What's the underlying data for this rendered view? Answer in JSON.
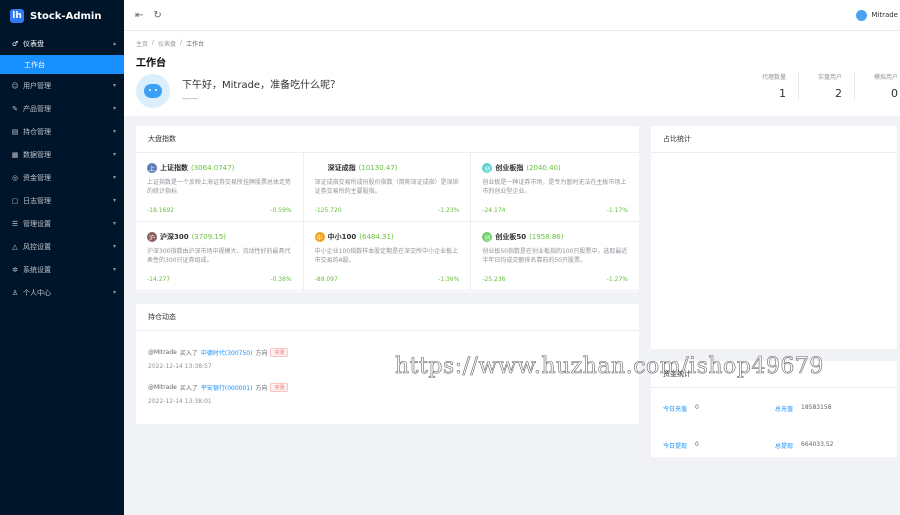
{
  "app": {
    "title": "Stock-Admin",
    "logo_glyph": "lh"
  },
  "sidebar": {
    "items": [
      {
        "icon": "dashboard-icon",
        "glyph": "♂",
        "label": "仪表盘",
        "open": true,
        "children": [
          {
            "label": "工作台",
            "active": true
          }
        ]
      },
      {
        "icon": "user-icon",
        "glyph": "☺",
        "label": "用户管理"
      },
      {
        "icon": "product-icon",
        "glyph": "✎",
        "label": "产品管理"
      },
      {
        "icon": "position-icon",
        "glyph": "▤",
        "label": "持仓管理"
      },
      {
        "icon": "data-icon",
        "glyph": "▦",
        "label": "数据管理"
      },
      {
        "icon": "fund-icon",
        "glyph": "◎",
        "label": "资金管理"
      },
      {
        "icon": "log-icon",
        "glyph": "▢",
        "label": "日志管理"
      },
      {
        "icon": "settings-admin-icon",
        "glyph": "☰",
        "label": "管理设置"
      },
      {
        "icon": "risk-icon",
        "glyph": "△",
        "label": "风控设置"
      },
      {
        "icon": "system-icon",
        "glyph": "✲",
        "label": "系统设置"
      },
      {
        "icon": "personal-icon",
        "glyph": "♙",
        "label": "个人中心"
      }
    ]
  },
  "header": {
    "collapse_glyph": "⇤",
    "refresh_glyph": "↻",
    "username": "Mitrade"
  },
  "breadcrumb": {
    "items": [
      "主页",
      "仪表盘",
      "工作台"
    ],
    "separator": "/"
  },
  "page": {
    "title": "工作台",
    "greeting": "下午好，Mitrade，准备吃什么呢？",
    "greeting_sub": "——",
    "stats": [
      {
        "label": "代理数量",
        "value": "1"
      },
      {
        "label": "实盘用户",
        "value": "2"
      },
      {
        "label": "模拟用户",
        "value": "0"
      }
    ]
  },
  "market": {
    "title": "大盘指数",
    "indices": [
      {
        "icon": "上",
        "color": "#5b7fb5",
        "name": "上证指数",
        "value": "(3064.0747)",
        "desc": "上证指数是一个反映上海证券交易所挂牌股票总体走势的统计指标",
        "change": "-18.1692",
        "pct": "-0.59%"
      },
      {
        "icon": "",
        "color": "#ffffff",
        "name": "深证成指",
        "value": "(10130.47)",
        "desc": "深证成指交易所成份股价指数（简称深证成指）是深圳证券交易所的主要股指。",
        "change": "-125.720",
        "pct": "-1.23%"
      },
      {
        "icon": "创",
        "color": "#5fd0cf",
        "name": "创业板指",
        "value": "(2040.40)",
        "desc": "创业板是一种证券市场，是专为暂时无法在主板市场上市的创业型企业。",
        "change": "-24.174",
        "pct": "-1.17%"
      },
      {
        "icon": "沪",
        "color": "#8b5a5a",
        "name": "沪深300",
        "value": "(3709.15)",
        "desc": "沪深300指数由沪深市场中规模大、流动性好的最具代表性的300只证券组成。",
        "change": "-14.277",
        "pct": "-0.38%"
      },
      {
        "icon": "中",
        "color": "#f0a020",
        "name": "中小100",
        "value": "(6484.31)",
        "desc": "中小企业100指数样本股定期是在深交所中小企业板上市交易的A股。",
        "change": "-89.097",
        "pct": "-1.36%"
      },
      {
        "icon": "创",
        "color": "#6ccf6c",
        "name": "创业板50",
        "value": "(1958.86)",
        "desc": "创业板50指数是在创业板指的100只股票中，选取最近半年日均成交额排名靠前的50只股票。",
        "change": "-25.236",
        "pct": "-1.27%"
      }
    ]
  },
  "positions": {
    "title": "持仓动态",
    "items": [
      {
        "user": "@Mitrade",
        "action": "买入了",
        "stock": "中德时代(300750)",
        "direction_label": "方向",
        "tag": "买涨",
        "time": "2022-12-14 13:38:57"
      },
      {
        "user": "@Mitrade",
        "action": "买入了",
        "stock": "平安银行(000001)",
        "direction_label": "方向",
        "tag": "买涨",
        "time": "2022-12-14 13:38:01"
      }
    ]
  },
  "ratio": {
    "title": "占比统计"
  },
  "funds": {
    "title": "资金统计",
    "rows": [
      [
        {
          "label": "今日充值",
          "value": "0"
        },
        {
          "label": "总充值",
          "value": "18583158"
        }
      ],
      [
        {
          "label": "今日提现",
          "value": "0"
        },
        {
          "label": "总提现",
          "value": "664033.52"
        }
      ]
    ]
  },
  "watermark": "https://www.huzhan.com/ishop49679"
}
